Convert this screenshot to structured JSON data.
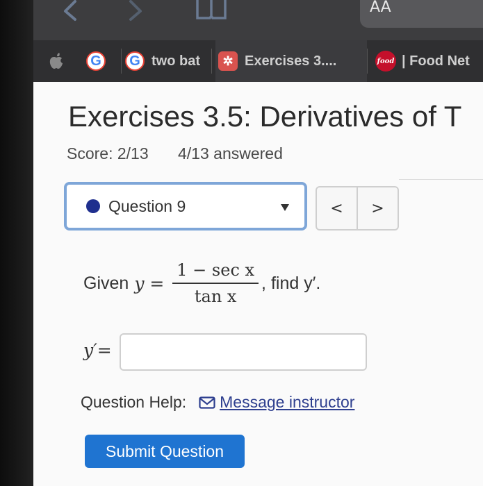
{
  "toolbar": {
    "reader_label": "AA",
    "colors": {
      "background": "#3d3d3f",
      "icons": "#6b7b93"
    }
  },
  "tabs": [
    {
      "label": "two bat",
      "icon": "google-icon"
    },
    {
      "label": "Exercises 3....",
      "icon": "exercise-icon"
    },
    {
      "label": "| Food Net",
      "icon": "food-icon",
      "icon_text": "food"
    }
  ],
  "google_letter": "G",
  "page": {
    "title": "Exercises 3.5: Derivatives of T",
    "score": "Score: 2/13",
    "answered": "4/13 answered"
  },
  "question_select": {
    "label": "Question 9"
  },
  "nav": {
    "prev": "<",
    "next": ">"
  },
  "problem": {
    "given": "Given",
    "y_var": "y",
    "equals": " = ",
    "numerator": "1 − sec x",
    "denominator": "tan x",
    "find": ", find y′."
  },
  "answer": {
    "label": "y′=",
    "value": ""
  },
  "help": {
    "label": "Question Help:",
    "link": "Message instructor"
  },
  "submit": {
    "label": "Submit Question"
  },
  "colors": {
    "accent": "#1f74d1",
    "select_border": "#7ea6d8",
    "dot": "#1f2f8e"
  }
}
